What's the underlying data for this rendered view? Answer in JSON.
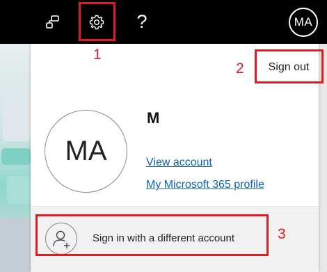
{
  "topbar": {
    "org_icon": "org-chart-icon",
    "settings_icon": "gear-icon",
    "help_label": "?",
    "avatar_initials": "MA"
  },
  "account_panel": {
    "sign_out_label": "Sign out",
    "avatar_initials": "MA",
    "user_name": "M",
    "view_account_label": "View account",
    "profile_link_label": "My Microsoft 365 profile",
    "switch_account_label": "Sign in with a different account",
    "switch_account_icon": "add-person-icon"
  },
  "annotations": {
    "callouts": [
      "1",
      "2",
      "3"
    ],
    "highlight_color": "#e01b24"
  },
  "colors": {
    "topbar_bg": "#000000",
    "link": "#0b63b6",
    "switch_row_bg": "#f1f1f1"
  }
}
